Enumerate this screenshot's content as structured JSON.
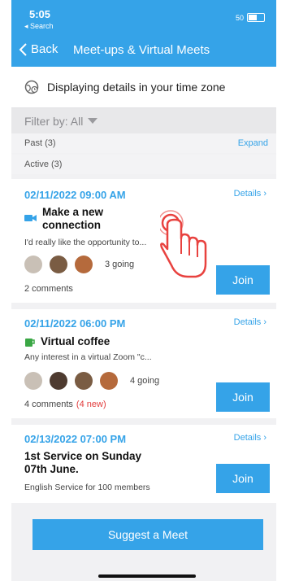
{
  "status": {
    "time": "5:05",
    "back_app": "◂ Search",
    "signal": "50"
  },
  "nav": {
    "back_label": "Back",
    "title": "Meet-ups & Virtual Meets"
  },
  "timezone": {
    "text": "Displaying details in your time zone"
  },
  "filter": {
    "label": "Filter by: All"
  },
  "sections": {
    "past": "Past (3)",
    "expand": "Expand",
    "active": "Active (3)"
  },
  "meets": [
    {
      "date": "02/11/2022 09:00 AM",
      "details": "Details",
      "title": "Make a new connection",
      "description": "I'd really like the opportunity to...",
      "going": "3 going",
      "comments": "2 comments",
      "new": "",
      "join": "Join"
    },
    {
      "date": "02/11/2022 06:00 PM",
      "details": "Details",
      "title": "Virtual coffee",
      "description": "Any interest in a virtual Zoom \"c...",
      "going": "4 going",
      "comments": "4 comments",
      "new": "(4 new)",
      "join": "Join"
    },
    {
      "date": "02/13/2022 07:00 PM",
      "details": "Details",
      "title": "1st Service on Sunday 07th June.",
      "description": "English Service for 100 members",
      "join": "Join"
    }
  ],
  "suggest": {
    "label": "Suggest a Meet"
  },
  "colors": {
    "accent": "#35a3e8",
    "new_badge": "#e23b3b"
  }
}
